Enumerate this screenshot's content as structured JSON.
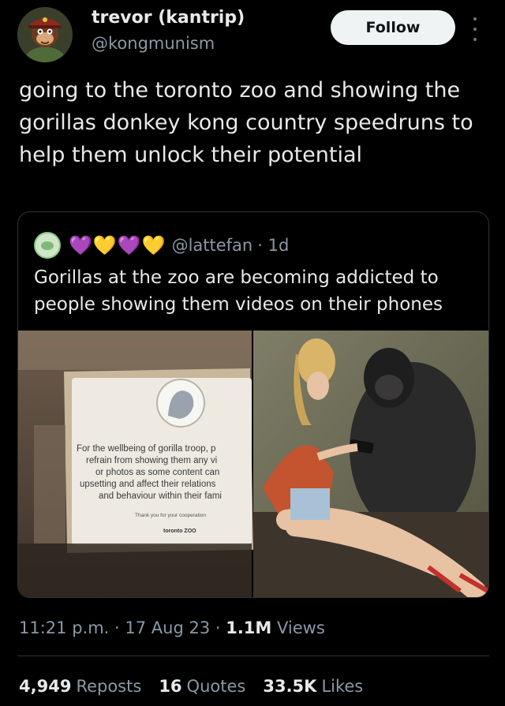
{
  "author": {
    "display_name": "trevor (kantrip)",
    "handle": "@kongmunism",
    "avatar_icon": "donkey-kong-soldier-avatar"
  },
  "follow_label": "Follow",
  "tweet_text": "going to the toronto zoo and showing the gorillas donkey kong country speedruns to help them unlock their potential",
  "quote": {
    "avatar_icon": "cream-circle-avatar",
    "hearts": [
      "💜",
      "💛",
      "💜",
      "💛"
    ],
    "handle": "@lattefan",
    "age": "· 1d",
    "text": "Gorillas at the zoo are becoming addicted to people showing them videos on their phones",
    "sign": {
      "lines": [
        "For the wellbeing of gorilla troop, p",
        "refrain from showing them any vi",
        "or photos as some content can",
        "upsetting and affect their relations",
        "and behaviour within their fami"
      ],
      "thanks": "Thank you for your cooperation",
      "zoo_logo": "toronto ZOO"
    }
  },
  "meta": {
    "time": "11:21 p.m.",
    "sep1": " · ",
    "date": "17 Aug 23",
    "sep2": " · ",
    "views_count": "1.1M",
    "views_label": " Views"
  },
  "stats": [
    {
      "count": "4,949",
      "label": "Reposts"
    },
    {
      "count": "16",
      "label": "Quotes"
    },
    {
      "count": "33.5K",
      "label": "Likes"
    }
  ],
  "colors": {
    "background": "#000000",
    "text_primary": "#e7e9ea",
    "text_secondary": "#8b98a5",
    "border": "#2f3336",
    "follow_bg": "#eff3f4"
  }
}
